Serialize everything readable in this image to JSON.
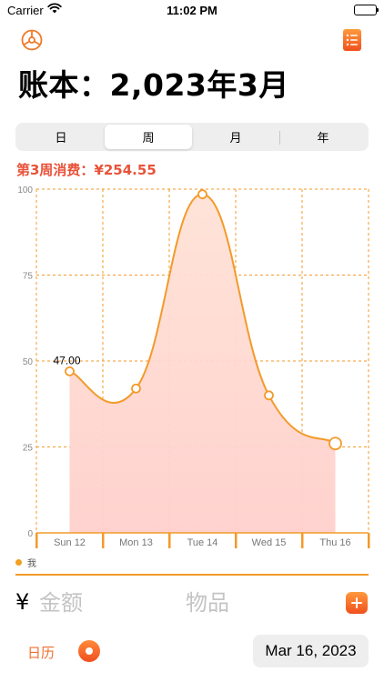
{
  "status_bar": {
    "carrier": "Carrier",
    "time": "11:02 PM"
  },
  "header": {
    "settings_icon": "gear-icon",
    "list_icon": "list-icon",
    "title": "账本：2,023年3月"
  },
  "segmented_control": {
    "items": [
      {
        "label": "日",
        "selected": false
      },
      {
        "label": "周",
        "selected": true
      },
      {
        "label": "月",
        "selected": false
      },
      {
        "label": "年",
        "selected": false
      }
    ]
  },
  "summary": {
    "week_total": "第3周消费：¥254.55"
  },
  "colors": {
    "accent": "#f39a2a",
    "total_text": "#e8533a",
    "fill_top": "#ffe2d6",
    "fill_bottom": "#ffd0cc"
  },
  "chart_data": {
    "type": "area",
    "categories": [
      "Sun 12",
      "Mon 13",
      "Tue 14",
      "Wed 15",
      "Thu 16"
    ],
    "series": [
      {
        "name": "我",
        "values": [
          47.0,
          42.0,
          98.5,
          40.0,
          26.0
        ]
      }
    ],
    "ylim": [
      0,
      100
    ],
    "yticks": [
      "0",
      "25",
      "50",
      "75",
      "100"
    ],
    "annotations": [
      {
        "category": "Sun 12",
        "label": "47.00"
      }
    ],
    "grid": true,
    "legend": "bottom-left"
  },
  "entry": {
    "currency_symbol": "¥",
    "amount_placeholder": "金额",
    "item_placeholder": "物品",
    "add_icon": "plus-icon"
  },
  "footer": {
    "calendar_label": "日历",
    "record_icon": "record-icon",
    "date": "Mar 16, 2023"
  }
}
